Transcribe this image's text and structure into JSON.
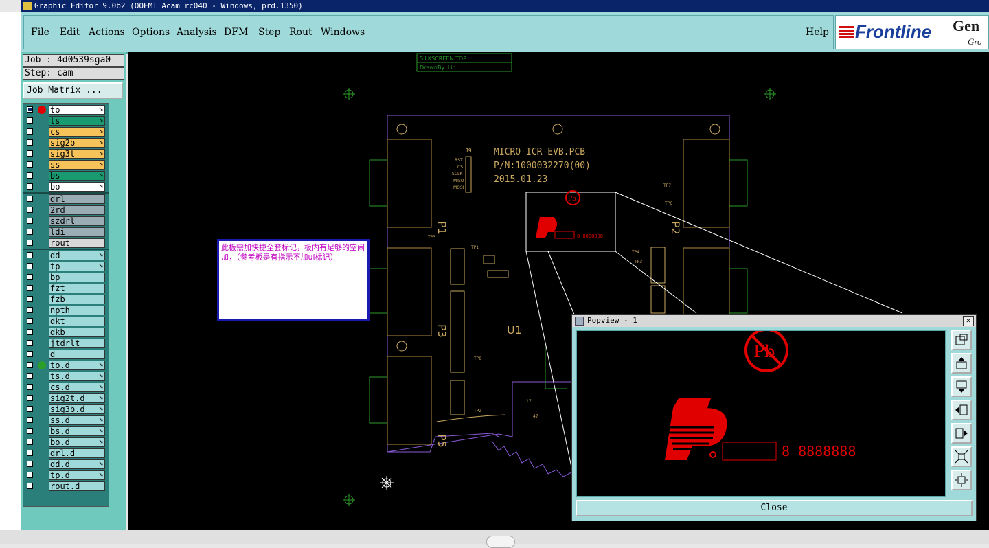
{
  "window": {
    "title": "Graphic Editor 9.0b2 (OOEMI Acam rc040 - Windows, prd.1350)"
  },
  "menu": {
    "items": [
      "File",
      "Edit",
      "Actions",
      "Options",
      "Analysis",
      "DFM",
      "Step",
      "Rout",
      "Windows"
    ],
    "help": "Help"
  },
  "logo": {
    "brand": "Frontline",
    "gen": "Gen",
    "sub": "Gro"
  },
  "panel": {
    "job": "Job : 4d0539sga0",
    "step": "Step: cam",
    "matrix_button": "Job Matrix ..."
  },
  "layers": [
    {
      "name": "to",
      "color": "#ffffff",
      "indicator": "#e00000",
      "active": true,
      "arrow": true
    },
    {
      "name": "ts",
      "color": "#1a9a70",
      "arrow": true
    },
    {
      "name": "cs",
      "color": "#f6c35a",
      "arrow": true
    },
    {
      "name": "sig2b",
      "color": "#f6c35a",
      "arrow": true
    },
    {
      "name": "sig3t",
      "color": "#f6c35a",
      "arrow": true
    },
    {
      "name": "ss",
      "color": "#f6c35a",
      "arrow": true
    },
    {
      "name": "bs",
      "color": "#1a9a70",
      "arrow": true
    },
    {
      "name": "bo",
      "color": "#ffffff",
      "arrow": true
    },
    {
      "name": "drl",
      "color": "#9aacb4"
    },
    {
      "name": "2rd",
      "color": "#9aacb4"
    },
    {
      "name": "szdrl",
      "color": "#9aacb4"
    },
    {
      "name": "ldi",
      "color": "#9aacb4"
    },
    {
      "name": "rout",
      "color": "#d9d9d9"
    },
    {
      "name": "dd",
      "color": "#9fd9d9",
      "arrow": true
    },
    {
      "name": "tp",
      "color": "#9fd9d9",
      "arrow": true
    },
    {
      "name": "bp",
      "color": "#9fd9d9"
    },
    {
      "name": "fzt",
      "color": "#9fd9d9"
    },
    {
      "name": "fzb",
      "color": "#9fd9d9"
    },
    {
      "name": "npth",
      "color": "#9fd9d9"
    },
    {
      "name": "dkt",
      "color": "#9fd9d9"
    },
    {
      "name": "dkb",
      "color": "#9fd9d9"
    },
    {
      "name": "jtdrlt",
      "color": "#9fd9d9"
    },
    {
      "name": "d",
      "color": "#9fd9d9"
    },
    {
      "name": "to.d",
      "color": "#9fd9d9",
      "indicator": "#2aa02a",
      "arrow": true
    },
    {
      "name": "ts.d",
      "color": "#9fd9d9",
      "arrow": true
    },
    {
      "name": "cs.d",
      "color": "#9fd9d9",
      "arrow": true
    },
    {
      "name": "sig2t.d",
      "color": "#9fd9d9",
      "arrow": true
    },
    {
      "name": "sig3b.d",
      "color": "#9fd9d9",
      "arrow": true
    },
    {
      "name": "ss.d",
      "color": "#9fd9d9",
      "arrow": true
    },
    {
      "name": "bs.d",
      "color": "#9fd9d9",
      "arrow": true
    },
    {
      "name": "bo.d",
      "color": "#9fd9d9",
      "arrow": true
    },
    {
      "name": "drl.d",
      "color": "#9fd9d9"
    },
    {
      "name": "dd.d",
      "color": "#9fd9d9",
      "arrow": true
    },
    {
      "name": "tp.d",
      "color": "#9fd9d9",
      "arrow": true
    },
    {
      "name": "rout.d",
      "color": "#9fd9d9"
    }
  ],
  "board": {
    "silk_title": "SILKSCREEN TOP",
    "drawn_by": "DrawnBy: Lin",
    "text1": "MICRO-ICR-EVB.PCB",
    "text2": "P/N:1000032270(00)",
    "text3": "2015.01.23",
    "j9": "J9",
    "j9_pins": [
      "RST",
      "CS",
      "SCLK",
      "MISO",
      "MOSI"
    ],
    "p1": "P1",
    "p2": "P2",
    "p3": "P3",
    "p5": "P5",
    "u1": "U1",
    "tp_labels": [
      "TP1",
      "TP3",
      "TP7",
      "TP4",
      "TP3",
      "TP8",
      "TP2",
      "TP6"
    ],
    "misc": [
      "17",
      "47"
    ]
  },
  "sticky_note": "此板需加快捷全套标记，板内有足够的空间加，（参考板是有指示不加ul标记）",
  "popview": {
    "title": "Popview - 1",
    "close_x": "✕",
    "pb": "Pb",
    "code": "8 8888888",
    "tools": [
      "zoom-area-icon",
      "pan-up-icon",
      "pan-down-icon",
      "pan-left-icon",
      "pan-right-icon",
      "zoom-out-icon",
      "zoom-fit-icon"
    ],
    "close_label": "Close"
  }
}
